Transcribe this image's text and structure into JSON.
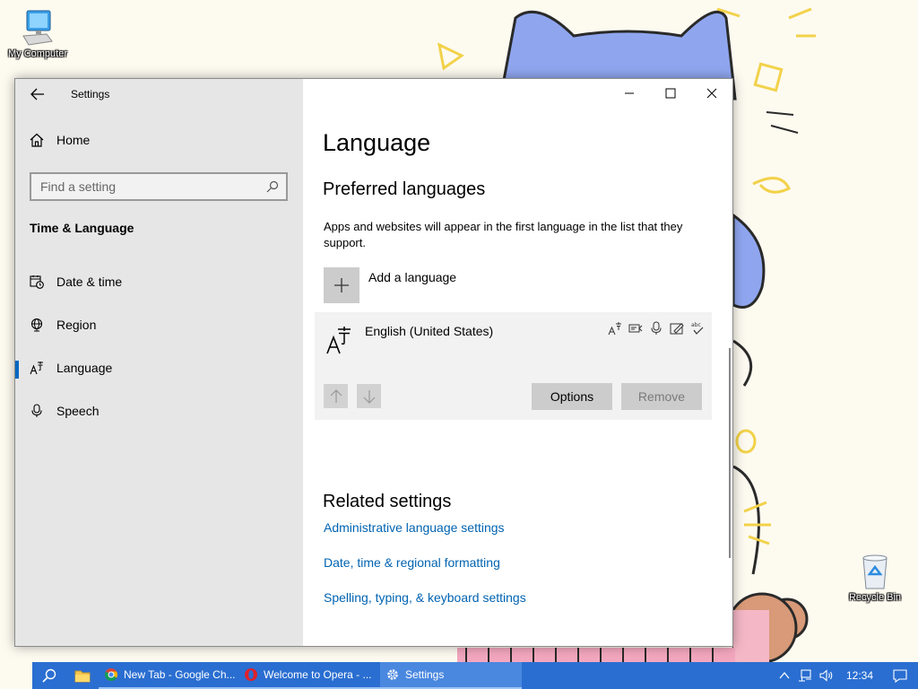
{
  "desktop": {
    "icons": [
      {
        "name": "my-computer",
        "label": "My Computer"
      },
      {
        "name": "recycle-bin",
        "label": "Recycle Bin"
      }
    ]
  },
  "window": {
    "title": "Settings",
    "controls": {
      "minimize": "minimize-icon",
      "maximize": "maximize-icon",
      "close": "close-icon"
    }
  },
  "sidebar": {
    "home_label": "Home",
    "search_placeholder": "Find a setting",
    "section_title": "Time & Language",
    "items": [
      {
        "label": "Date & time",
        "icon": "calendar-clock-icon"
      },
      {
        "label": "Region",
        "icon": "globe-icon"
      },
      {
        "label": "Language",
        "icon": "language-icon",
        "selected": true
      },
      {
        "label": "Speech",
        "icon": "microphone-icon"
      }
    ]
  },
  "main": {
    "page_title": "Language",
    "preferred_title": "Preferred languages",
    "preferred_desc": "Apps and websites will appear in the first language in the list that they support.",
    "add_language_label": "Add a language",
    "languages": [
      {
        "name": "English (United States)",
        "features": [
          "display-language-icon",
          "text-to-speech-icon",
          "speech-recognition-icon",
          "handwriting-icon",
          "spellcheck-icon"
        ],
        "options_label": "Options",
        "remove_label": "Remove"
      }
    ],
    "related_title": "Related settings",
    "related_links": [
      "Administrative language settings",
      "Date, time & regional formatting",
      "Spelling, typing, & keyboard settings"
    ]
  },
  "taskbar": {
    "apps": [
      {
        "label": "New Tab - Google Ch...",
        "icon": "chrome-icon"
      },
      {
        "label": "Welcome to Opera - ...",
        "icon": "opera-icon"
      },
      {
        "label": "Settings",
        "icon": "gear-icon",
        "active": true
      }
    ],
    "clock": "12:34"
  },
  "colors": {
    "accent": "#0067c0",
    "link": "#0063b1",
    "taskbar": "#2a6ed1"
  }
}
